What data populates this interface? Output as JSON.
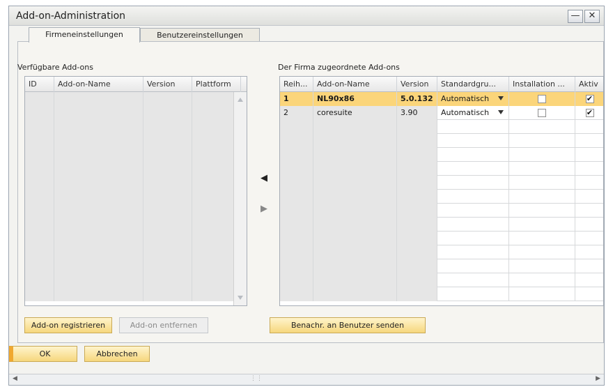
{
  "window": {
    "title": "Add-on-Administration"
  },
  "tabs": [
    {
      "label": "Firmeneinstellungen",
      "active": true
    },
    {
      "label": "Benutzereinstellungen",
      "active": false
    }
  ],
  "available": {
    "label": "Verfügbare Add-ons",
    "columns": [
      "ID",
      "Add-on-Name",
      "Version",
      "Plattform"
    ],
    "rows": []
  },
  "assigned": {
    "label": "Der Firma zugeordnete Add-ons",
    "columns": [
      "Reih...",
      "Add-on-Name",
      "Version",
      "Standardgru...",
      "Installation ...",
      "Aktiv"
    ],
    "rows": [
      {
        "num": "1",
        "name": "NL90x86",
        "version": "5.0.132",
        "group": "Automatisch",
        "install": false,
        "active": true,
        "selected": true
      },
      {
        "num": "2",
        "name": "coresuite",
        "version": "3.90",
        "group": "Automatisch",
        "install": false,
        "active": true,
        "selected": false
      }
    ]
  },
  "buttons": {
    "register": "Add-on registrieren",
    "remove": "Add-on entfernen",
    "notify": "Benachr. an Benutzer senden",
    "ok": "OK",
    "cancel": "Abbrechen"
  },
  "move": {
    "left_icon": "move-left-icon",
    "right_icon": "move-right-icon"
  },
  "colors": {
    "selected_row": "#fbd57a",
    "button": "#f6d77d"
  }
}
